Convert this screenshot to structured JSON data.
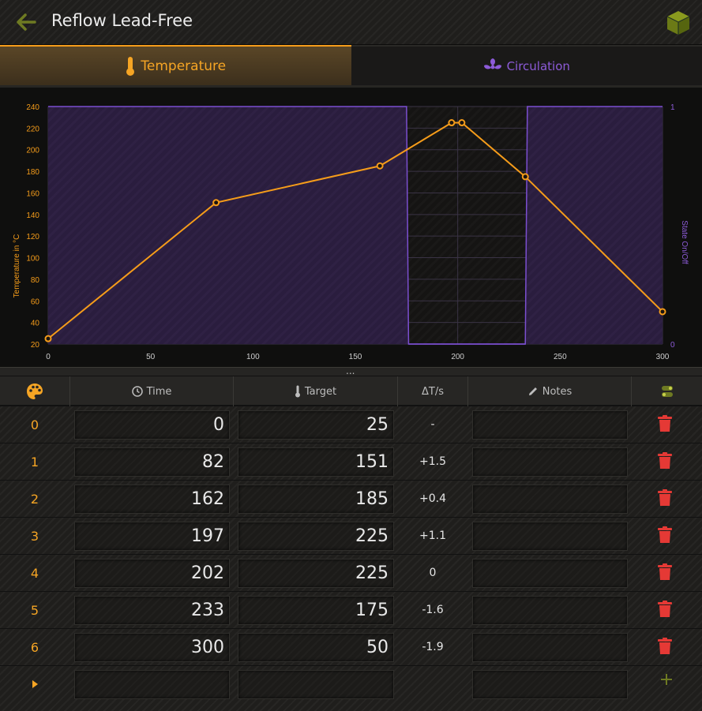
{
  "header": {
    "title": "Reflow Lead-Free",
    "accent_color": "#f59c1a",
    "back_icon": "arrow-left-icon",
    "cube_icon": "cube-icon"
  },
  "tabs": [
    {
      "label": "Temperature",
      "icon": "thermometer-icon",
      "active": true
    },
    {
      "label": "Circulation",
      "icon": "fan-icon",
      "active": false
    }
  ],
  "chart_data": {
    "type": "line",
    "ylabel": "Temperature in °C",
    "y2label": "State On/Off",
    "xlim": [
      0,
      300
    ],
    "ylim": [
      20,
      240
    ],
    "y2lim": [
      0,
      1
    ],
    "x_ticks": [
      "0",
      "50",
      "100",
      "150",
      "200",
      "250",
      "300"
    ],
    "y_ticks": [
      "20",
      "40",
      "60",
      "80",
      "100",
      "120",
      "140",
      "160",
      "180",
      "200",
      "220",
      "240"
    ],
    "y2_ticks": [
      "0",
      "1"
    ],
    "grid": true,
    "series": [
      {
        "color": "#f59c1a",
        "points": [
          [
            0,
            25
          ],
          [
            82,
            151
          ],
          [
            162,
            185
          ],
          [
            197,
            225
          ],
          [
            202,
            225
          ],
          [
            233,
            175
          ],
          [
            300,
            50
          ]
        ]
      },
      {
        "color": "#7b4fd0",
        "axis": "right",
        "points": [
          [
            0,
            1
          ],
          [
            175,
            1
          ],
          [
            176,
            0
          ],
          [
            233,
            0
          ],
          [
            234,
            1
          ],
          [
            300,
            1
          ]
        ]
      }
    ]
  },
  "splitter_label": "...",
  "table": {
    "headers": {
      "palette_icon": "palette-icon",
      "time": "Time",
      "target": "Target",
      "delta": "ΔT/s",
      "notes": "Notes",
      "toggle_icon": "toggle-icon"
    },
    "rows": [
      {
        "index": "0",
        "time": "0",
        "target": "25",
        "delta": "-",
        "notes": ""
      },
      {
        "index": "1",
        "time": "82",
        "target": "151",
        "delta": "+1.5",
        "notes": ""
      },
      {
        "index": "2",
        "time": "162",
        "target": "185",
        "delta": "+0.4",
        "notes": ""
      },
      {
        "index": "3",
        "time": "197",
        "target": "225",
        "delta": "+1.1",
        "notes": ""
      },
      {
        "index": "4",
        "time": "202",
        "target": "225",
        "delta": "0",
        "notes": ""
      },
      {
        "index": "5",
        "time": "233",
        "target": "175",
        "delta": "-1.6",
        "notes": ""
      },
      {
        "index": "6",
        "time": "300",
        "target": "50",
        "delta": "-1.9",
        "notes": ""
      }
    ],
    "new_row": {
      "index_icon": "caret-right-icon",
      "add_icon": "plus-icon"
    }
  }
}
